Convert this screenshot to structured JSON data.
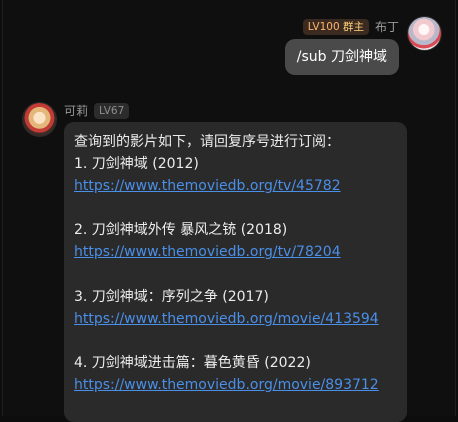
{
  "outgoing": {
    "level_badge": "LV100",
    "role_badge": "群主",
    "sender": "布丁",
    "message": "/sub 刀剑神域"
  },
  "incoming": {
    "sender": "可莉",
    "level_badge": "LV67",
    "intro": "查询到的影片如下，请回复序号进行订阅：",
    "results": [
      {
        "title": "1. 刀剑神域 (2012)",
        "url": "https://www.themoviedb.org/tv/45782"
      },
      {
        "title": "2. 刀剑神域外传 暴风之铳 (2018)",
        "url": "https://www.themoviedb.org/tv/78204"
      },
      {
        "title": "3. 刀剑神域：序列之争 (2017)",
        "url": "https://www.themoviedb.org/movie/413594"
      },
      {
        "title": "4. 刀剑神域进击篇：暮色黄昏 (2022)",
        "url": "https://www.themoviedb.org/movie/893712"
      }
    ]
  }
}
